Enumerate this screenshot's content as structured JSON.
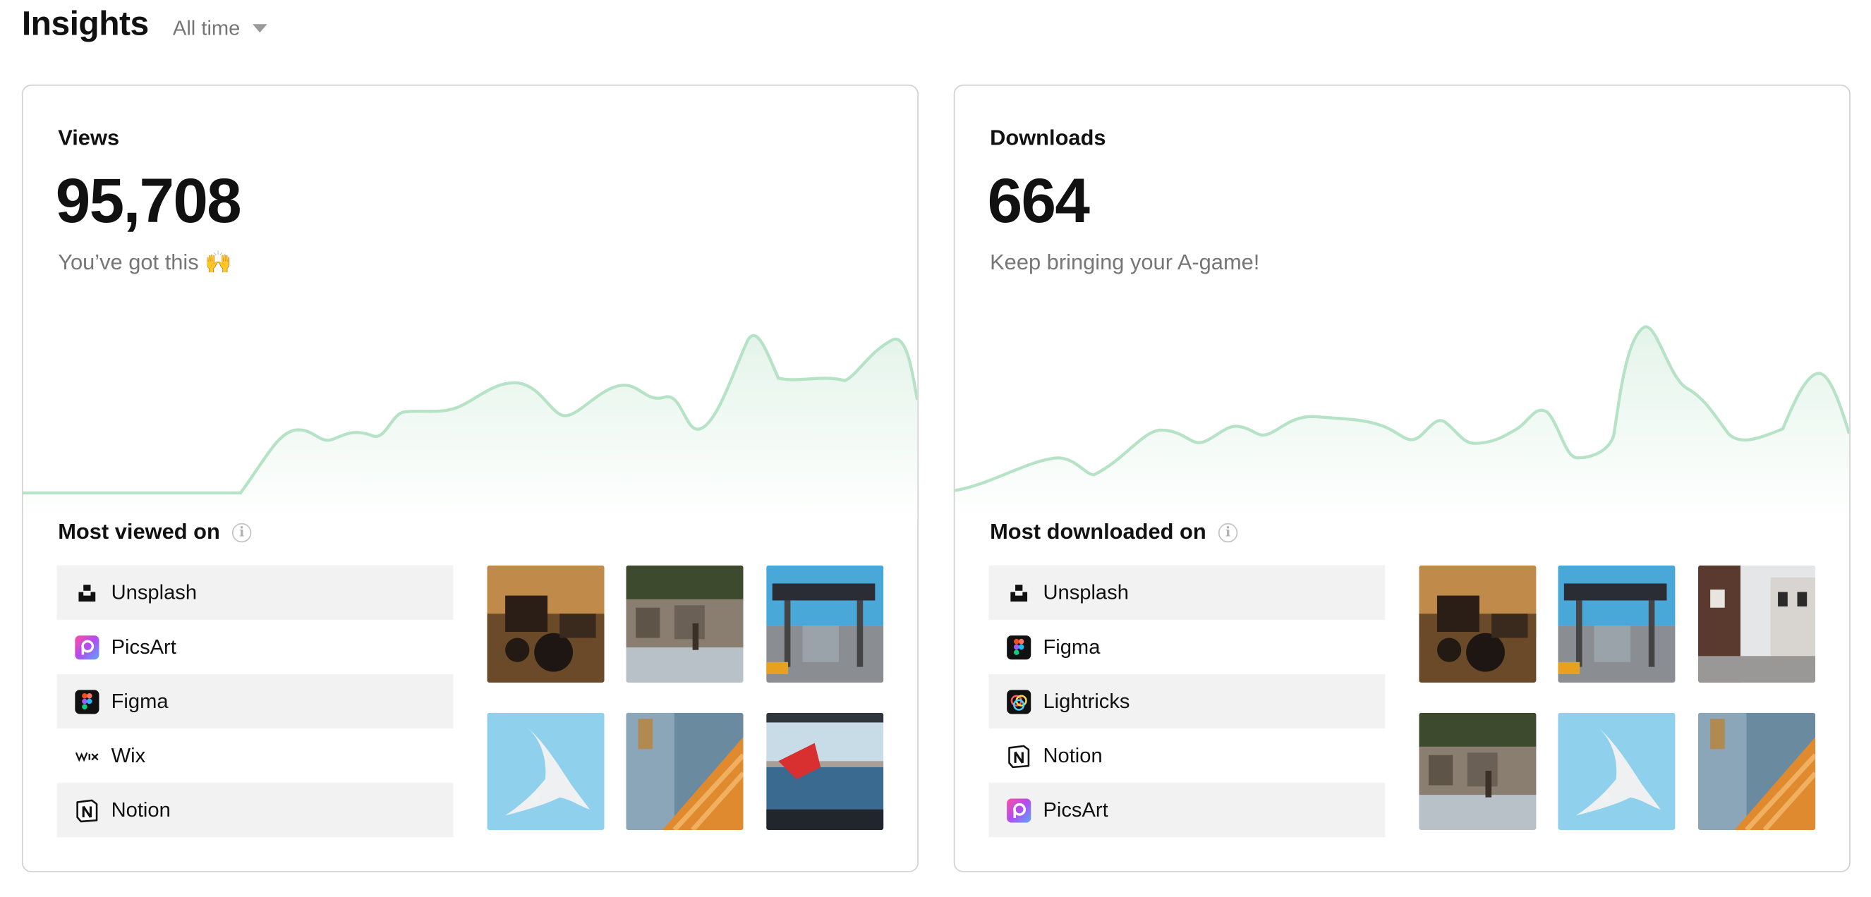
{
  "header": {
    "title": "Insights",
    "range": "All time"
  },
  "colors": {
    "sparkline": "#b6e2c6",
    "sparkline_fill": "#eef8f2",
    "row_shade": "#f2f2f2"
  },
  "views": {
    "label": "Views",
    "value": "95,708",
    "subtitle": "You’ve got this",
    "emoji": "🙌",
    "section_title": "Most viewed on",
    "platforms": [
      {
        "name": "Unsplash",
        "icon": "unsplash-icon"
      },
      {
        "name": "PicsArt",
        "icon": "picsart-icon"
      },
      {
        "name": "Figma",
        "icon": "figma-icon"
      },
      {
        "name": "Wix",
        "icon": "wix-icon"
      },
      {
        "name": "Notion",
        "icon": "notion-icon"
      }
    ],
    "thumbnails": [
      "tractor-photo",
      "mural-wall-photo",
      "city-street-sign-photo",
      "seagull-photo",
      "staircase-photo",
      "flag-sea-photo"
    ]
  },
  "downloads": {
    "label": "Downloads",
    "value": "664",
    "subtitle": "Keep bringing your A-game!",
    "section_title": "Most downloaded on",
    "platforms": [
      {
        "name": "Unsplash",
        "icon": "unsplash-icon"
      },
      {
        "name": "Figma",
        "icon": "figma-icon"
      },
      {
        "name": "Lightricks",
        "icon": "lightricks-icon"
      },
      {
        "name": "Notion",
        "icon": "notion-icon"
      },
      {
        "name": "PicsArt",
        "icon": "picsart-icon"
      }
    ],
    "thumbnails": [
      "tractor-photo",
      "city-street-sign-photo",
      "old-houses-street-photo",
      "mural-wall-photo",
      "seagull-photo",
      "staircase-photo"
    ]
  }
}
